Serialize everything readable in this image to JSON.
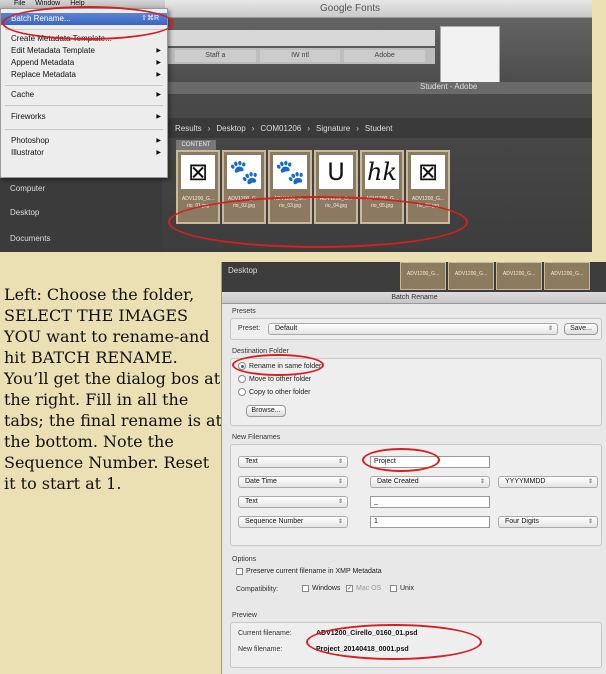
{
  "menu_bar": [
    "File",
    "Window",
    "Help"
  ],
  "app_menu": [
    {
      "label": "Batch Rename...",
      "shortcut": "⇧⌘R",
      "selected": true
    },
    {
      "label": "Create Metadata Template..."
    },
    {
      "label": "Edit Metadata Template",
      "submenu": true
    },
    {
      "label": "Append Metadata",
      "submenu": true
    },
    {
      "label": "Replace Metadata",
      "submenu": true
    },
    {
      "label": "Cache",
      "submenu": true
    },
    {
      "label": "Fireworks",
      "submenu": true
    },
    {
      "label": "Photoshop",
      "submenu": true
    },
    {
      "label": "Illustrator",
      "submenu": true
    }
  ],
  "browser_title": "Google Fonts",
  "browser_tabs": [
    "Staff a",
    "IW ntl",
    "Adobe"
  ],
  "workspace_label": "Student - Adobe",
  "path_bar": [
    "Results",
    "Desktop",
    "COM01206",
    "Signature",
    "Student"
  ],
  "content_label": "CONTENT",
  "sidebar_left": [
    "Computer",
    "Desktop",
    "Documents"
  ],
  "thumbnails": [
    {
      "glyph": "⊠",
      "caption": "ADV1200_G... rio_01.jpg"
    },
    {
      "glyph": "🐾",
      "caption": "ADV1200_G... rio_02.jpg"
    },
    {
      "glyph": "🐾",
      "caption": "ADV1200_G... rio_03.jpg"
    },
    {
      "glyph": "U",
      "caption": "ADV1200_G... rio_04.jpg"
    },
    {
      "glyph": "hk",
      "caption": "ADV1200_G... rio_05.jpg"
    },
    {
      "glyph": "⊠",
      "caption": "ADV1200_G... rio_06.jpg"
    }
  ],
  "dialog": {
    "desktop_label": "Desktop",
    "thumb_captions": [
      "ADV1200_G...",
      "ADV1200_G...",
      "ADV1200_G...",
      "ADV1200_G..."
    ],
    "title": "Batch Rename",
    "presets_header": "Presets",
    "preset_label": "Preset:",
    "preset_value": "Default",
    "save_button": "Save...",
    "destination_header": "Destination Folder",
    "dest_options": [
      "Rename in same folder",
      "Move to other folder",
      "Copy to other folder"
    ],
    "browse_button": "Browse...",
    "new_filenames_header": "New Filenames",
    "rows": [
      {
        "type": "Text",
        "value": "Project",
        "extra": ""
      },
      {
        "type": "Date Time",
        "value": "Date Created",
        "extra": "YYYYMMDD"
      },
      {
        "type": "Text",
        "value": "_",
        "extra": ""
      },
      {
        "type": "Sequence Number",
        "value": "1",
        "extra": "Four Digits"
      }
    ],
    "options_header": "Options",
    "preserve_label": "Preserve current filename in XMP Metadata",
    "compat_label": "Compatibility:",
    "compat_options": [
      "Windows",
      "Mac OS",
      "Unix"
    ],
    "preview_header": "Preview",
    "current_label": "Current filename:",
    "current_value": "ADV1200_Cirello_0160_01.psd",
    "new_label": "New filename:",
    "new_value": "Project_20140418_0001.psd"
  },
  "caption": "Left: Choose the folder, SELECT THE IMAGES YOU want to rename-and hit BATCH RENAME. You’ll get the dialog bos at the right. Fill in all the tabs; the final rename is at the bottom. Note the Sequence Number. Reset it to start at 1.",
  "colors": {
    "highlight_oval": "#d42020",
    "background": "#eae0b4",
    "menu_selected": "#3d64be"
  }
}
